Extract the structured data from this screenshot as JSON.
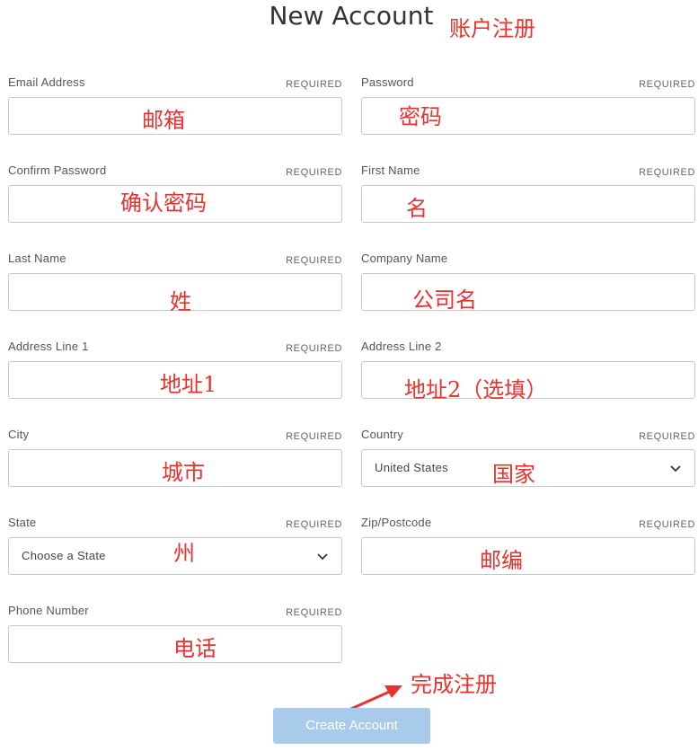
{
  "header": {
    "title": "New Account",
    "annotation": "账户注册"
  },
  "required_text": "REQUIRED",
  "fields": {
    "email": {
      "label": "Email Address",
      "annotation": "邮箱"
    },
    "password": {
      "label": "Password",
      "annotation": "密码"
    },
    "confirm_password": {
      "label": "Confirm Password",
      "annotation": "确认密码"
    },
    "first_name": {
      "label": "First Name",
      "annotation": "名"
    },
    "last_name": {
      "label": "Last Name",
      "annotation": "姓"
    },
    "company_name": {
      "label": "Company Name",
      "annotation": "公司名"
    },
    "address_line_1": {
      "label": "Address Line 1",
      "annotation": "地址1"
    },
    "address_line_2": {
      "label": "Address Line 2",
      "annotation": "地址2（选填）"
    },
    "city": {
      "label": "City",
      "annotation": "城市"
    },
    "country": {
      "label": "Country",
      "selected": "United States",
      "annotation": "国家"
    },
    "state": {
      "label": "State",
      "selected": "Choose a State",
      "annotation": "州"
    },
    "zip": {
      "label": "Zip/Postcode",
      "annotation": "邮编"
    },
    "phone": {
      "label": "Phone Number",
      "annotation": "电话"
    }
  },
  "submit": {
    "label": "Create Account",
    "annotation": "完成注册"
  },
  "colors": {
    "annotation": "#e8322e",
    "button": "#a9cbea",
    "border": "#c8c8c8"
  }
}
